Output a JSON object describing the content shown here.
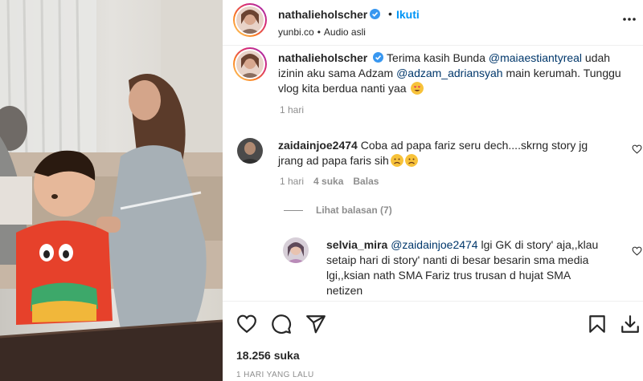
{
  "post": {
    "username": "nathalieholscher",
    "follow_label": "Ikuti",
    "location": "yunbi.co",
    "audio": "Audio asli",
    "likes": "18.256 suka",
    "date": "1 HARI YANG LALU"
  },
  "caption": {
    "username": "nathalieholscher",
    "text_1": "Terima kasih Bunda ",
    "mention_1": "@maiaestiantyreal",
    "text_2": " udah izinin aku sama Adzam ",
    "mention_2": "@adzam_adriansyah",
    "text_3": " main kerumah. Tunggu vlog kita berdua nanti yaa",
    "emoji": "smiling-face-with-heart-eyes",
    "time": "1 hari"
  },
  "comments": [
    {
      "username": "zaidainjoe2474",
      "text_a": "Coba ad papa fariz seru dech....skrng story jg",
      "text_b": "jrang ad papa faris sih",
      "emojis": [
        "sad-face",
        "sad-face"
      ],
      "time": "1 hari",
      "likes": "4 suka",
      "reply": "Balas"
    }
  ],
  "view_replies": "Lihat balasan (7)",
  "reply": {
    "username": "selvia_mira",
    "mention": "@zaidainjoe2474",
    "text_a": " lgi GK di story' aja,,klau",
    "text_b": "setaip hari di story' nanti di besar besarin sma media",
    "text_c": "lgi,,ksian nath SMA Fariz trus trusan d hujat SMA",
    "text_d": "netizen"
  },
  "colors": {
    "accent": "#0095f6",
    "mention": "#00376b",
    "muted": "#8e8e8e",
    "verified": "#3897f0"
  },
  "icons": [
    "verified-badge-icon",
    "more-options-icon",
    "heart-icon",
    "comment-icon",
    "share-icon",
    "bookmark-icon",
    "download-icon"
  ]
}
